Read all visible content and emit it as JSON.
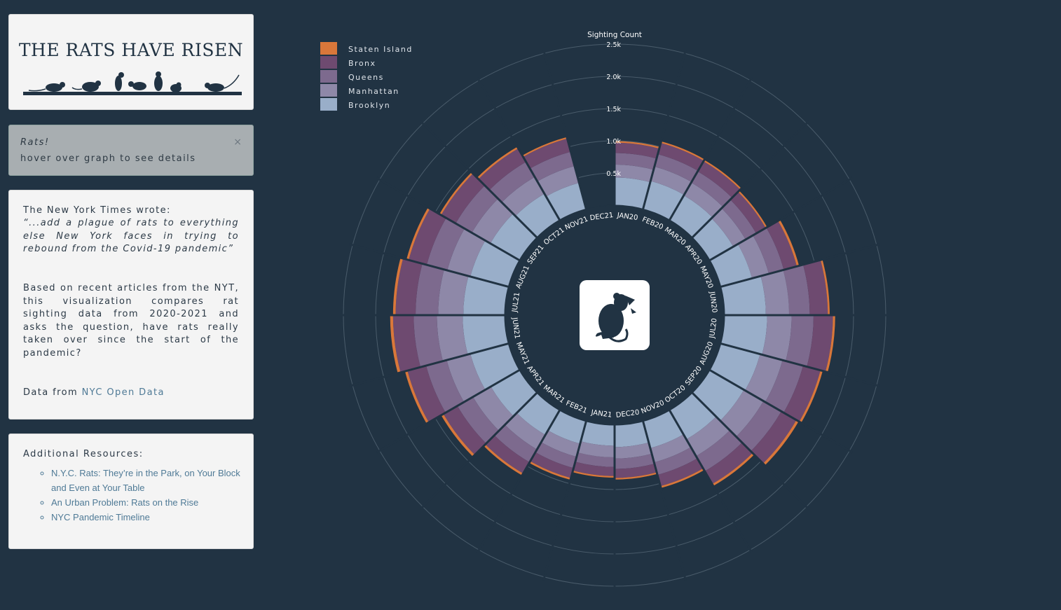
{
  "header": {
    "title": "THE RATS HAVE RISEN"
  },
  "alert": {
    "heading": "Rats!",
    "body": "hover over graph to see details",
    "close": "×"
  },
  "info": {
    "intro": "The New York Times wrote:",
    "quote": "“...add a plague of rats to everything else New York faces in trying to rebound from the Covid-19 pandemic”",
    "paragraph": "Based on recent articles from the NYT, this visualization compares rat sighting data from 2020-2021 and asks the question, have rats really taken over since the start of the pandemic?",
    "source_prefix": "Data from ",
    "source_link": "NYC Open Data"
  },
  "resources": {
    "heading": "Additional Resources:",
    "links": [
      "N.Y.C. Rats: They’re in the Park, on Your Block and Even at Your Table",
      "An Urban Problem: Rats on the Rise",
      "NYC Pandemic Timeline"
    ]
  },
  "colors": {
    "background": "#213343",
    "Staten Island": "#d9773a",
    "Bronx": "#6e4a70",
    "Queens": "#7d6a8e",
    "Manhattan": "#8e88a8",
    "Brooklyn": "#99aec9"
  },
  "center_icon": "rat-icon",
  "chart_data": {
    "type": "stacked-polar-bar",
    "radial_axis_title": "Sighting Count",
    "radial_ticks": [
      0.5,
      1.0,
      1.5,
      2.0,
      2.5
    ],
    "radial_tick_labels": [
      "0.5k",
      "1.0k",
      "1.5k",
      "2.0k",
      "2.5k"
    ],
    "radial_range": [
      0,
      2500
    ],
    "legend_position": "top-left",
    "categories": [
      "JAN20",
      "FEB20",
      "MAR20",
      "APR20",
      "MAY20",
      "JUN20",
      "JUL20",
      "AUG20",
      "SEP20",
      "OCT20",
      "NOV20",
      "DEC20",
      "JAN21",
      "FEB21",
      "MAR21",
      "APR21",
      "MAY21",
      "JUN21",
      "JUL21",
      "AUG21",
      "SEP21",
      "OCT21",
      "NOV21",
      "DEC21"
    ],
    "series": [
      {
        "name": "Brooklyn",
        "values": [
          430,
          450,
          440,
          420,
          500,
          640,
          660,
          630,
          610,
          520,
          430,
          340,
          320,
          360,
          440,
          510,
          610,
          650,
          640,
          610,
          520,
          470,
          420,
          0
        ]
      },
      {
        "name": "Manhattan",
        "values": [
          200,
          230,
          230,
          220,
          270,
          360,
          380,
          360,
          350,
          300,
          230,
          180,
          180,
          210,
          260,
          320,
          380,
          400,
          390,
          370,
          330,
          300,
          270,
          0
        ]
      },
      {
        "name": "Queens",
        "values": [
          180,
          200,
          200,
          190,
          240,
          320,
          340,
          330,
          320,
          270,
          200,
          160,
          150,
          180,
          230,
          280,
          330,
          360,
          350,
          330,
          290,
          270,
          230,
          0
        ]
      },
      {
        "name": "Bronx",
        "values": [
          160,
          180,
          180,
          170,
          210,
          280,
          300,
          280,
          270,
          230,
          180,
          140,
          140,
          160,
          200,
          250,
          300,
          320,
          310,
          290,
          260,
          240,
          210,
          0
        ]
      },
      {
        "name": "Staten Island",
        "values": [
          25,
          25,
          25,
          25,
          35,
          30,
          35,
          35,
          40,
          35,
          30,
          25,
          25,
          30,
          35,
          40,
          40,
          45,
          40,
          35,
          30,
          30,
          25,
          0
        ]
      }
    ]
  }
}
